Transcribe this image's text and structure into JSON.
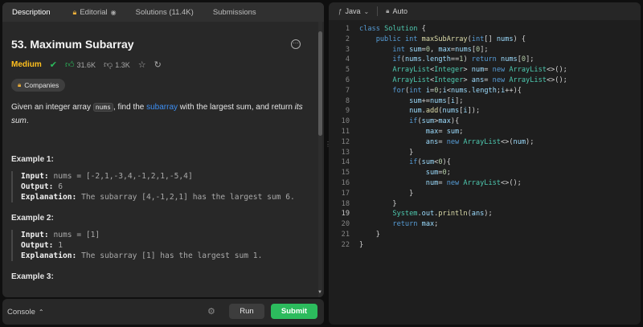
{
  "tabs": [
    {
      "label": "Description",
      "icon": ""
    },
    {
      "label": "Editorial",
      "icon": "lock-icon"
    },
    {
      "label": "Solutions (11.4K)",
      "icon": ""
    },
    {
      "label": "Submissions",
      "icon": ""
    }
  ],
  "problem": {
    "title": "53. Maximum Subarray",
    "difficulty": "Medium",
    "likes": "31.6K",
    "dislikes": "1.3K",
    "companies_label": "Companies",
    "desc_pre": "Given an integer array ",
    "desc_code": "nums",
    "desc_mid": ", find the ",
    "desc_link": "subarray",
    "desc_post": " with the largest sum, and return ",
    "desc_em": "its sum",
    "desc_end": "."
  },
  "examples": [
    {
      "title": "Example 1:",
      "input": "nums = [-2,1,-3,4,-1,2,1,-5,4]",
      "output": "6",
      "explanation": "The subarray [4,-1,2,1] has the largest sum 6."
    },
    {
      "title": "Example 2:",
      "input": "nums = [1]",
      "output": "1",
      "explanation": "The subarray [1] has the largest sum 1."
    },
    {
      "title": "Example 3:"
    }
  ],
  "labels": {
    "input": "Input:",
    "output": "Output:",
    "explanation": "Explanation:"
  },
  "bottom": {
    "console": "Console",
    "run": "Run",
    "submit": "Submit"
  },
  "editor": {
    "language": "Java",
    "mode": "Auto",
    "current_line": 19
  },
  "colors": {
    "accent_green": "#2cbb5d",
    "medium": "#ffc01e",
    "link": "#3d8ef2"
  }
}
